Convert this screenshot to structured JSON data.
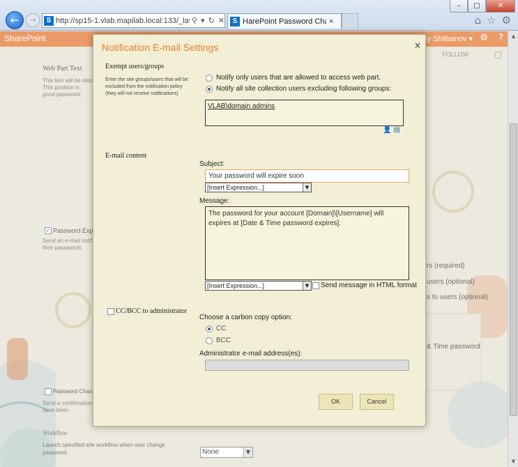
{
  "browser": {
    "url": "http://sp15-1.vlab.mapilab.local:133/_layouts/15/l",
    "url_icons": [
      "search-icon",
      "dropdown-icon",
      "refresh-icon",
      "close-icon"
    ],
    "tab_title": "HarePoint Password Chang...",
    "tab_close": "×",
    "window_buttons": [
      "–",
      "□",
      "✕"
    ]
  },
  "sharepoint": {
    "brand": "SharePoint",
    "user": "ey Shlibanov ▾",
    "follow": "FOLLOW",
    "left": {
      "web_part_text": "Web Part Text",
      "web_part_desc": "This text will be disp This position is good password policy ther",
      "password_expiry_label": "Password Expi",
      "send_email_desc": "Send an e-mail notif their passwords expi",
      "password_change_label": "Password Chan",
      "confirm_desc": "Send a confirmation have been successful",
      "workflow_title": "Workflow",
      "workflow_desc": "Launch specified site workflow when user change password.",
      "workflow_select": "None"
    },
    "right": {
      "opt1": "rs (required)",
      "opt2": "users (optional)",
      "opt3": "s to users (optional)",
      "opt4": "& Time password"
    }
  },
  "dialog": {
    "title": "Notification E-mail Settings",
    "close_label": "×",
    "exempt": {
      "heading": "Exempt users/groups",
      "description": "Enter the site groups/users that will be excluded from the notification policy (they will not receive notifications)",
      "option_allowed": "Notify only users that are allowed to access web part.",
      "option_all": "Notify all site collection users excluding following groups:",
      "selected_option": "all",
      "groups_value": "VLAB\\domain admins"
    },
    "email_content": {
      "heading": "E-mail content",
      "subject_label": "Subject:",
      "subject_value": "Your password will expire soon",
      "insert_expression": "[Insert Expression...]",
      "message_label": "Message:",
      "message_value": "The password for your account [Domain]\\[Username] will expires at [Date & Time password expires].",
      "html_format_label": "Send message in HTML format",
      "html_format_checked": false
    },
    "cc": {
      "checkbox_label": "CC/BCC to administrator",
      "checked": false,
      "choose_label": "Choose a carbon copy option:",
      "option_cc": "CC",
      "option_bcc": "BCC",
      "selected": "CC",
      "admin_email_label": "Administrator e-mail address(es):",
      "admin_email_value": ""
    },
    "buttons": {
      "ok": "OK",
      "cancel": "Cancel"
    }
  },
  "colors": {
    "dialog_bg": "#f2efd6",
    "title_orange": "#e57f2f",
    "sharepoint_bar": "#e98a4e"
  }
}
